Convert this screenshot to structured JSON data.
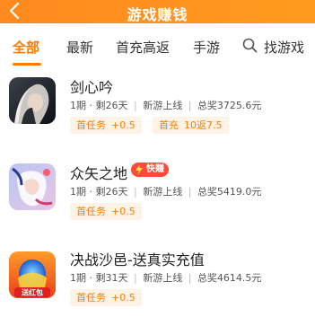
{
  "header": {
    "title": "游戏赚钱"
  },
  "tabs": [
    {
      "label": "全部",
      "active": true
    },
    {
      "label": "最新",
      "active": false
    },
    {
      "label": "首充高返",
      "active": false
    },
    {
      "label": "手游",
      "active": false
    }
  ],
  "search_tab": {
    "label": "找游戏",
    "icon": "search-icon"
  },
  "accent_color": "#ff7a00",
  "games": [
    {
      "name": "剑心吟",
      "period": "1期",
      "remaining": "剩26天",
      "status": "新游上线",
      "total": "总奖3725.6元",
      "tags": [
        {
          "label": "首任务",
          "value": "+0.5"
        },
        {
          "label": "首充",
          "value": "10返7.5"
        }
      ]
    },
    {
      "name": "众矢之地",
      "badge": "快赚",
      "period": "1期",
      "remaining": "剩26天",
      "status": "新游上线",
      "total": "总奖5419.0元",
      "tags": [
        {
          "label": "首任务",
          "value": "+0.5"
        }
      ]
    },
    {
      "name": "决战沙邑-送真实充值",
      "icon_text": "送红包",
      "period": "1期",
      "remaining": "剩31天",
      "status": "新游上线",
      "total": "总奖4614.5元",
      "tags": [
        {
          "label": "首任务",
          "value": "+0.5"
        }
      ]
    }
  ]
}
